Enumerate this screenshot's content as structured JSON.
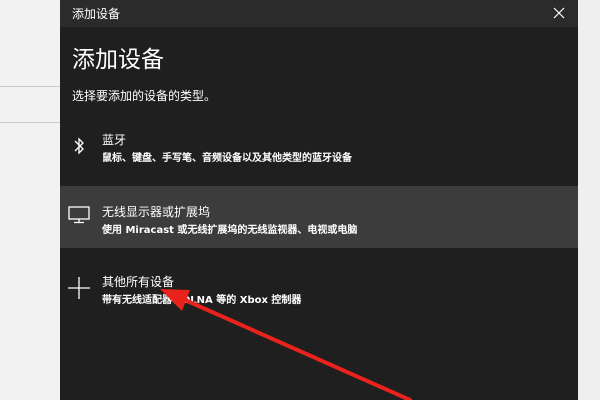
{
  "dialog": {
    "window_title": "添加设备",
    "heading": "添加设备",
    "subheading": "选择要添加的设备的类型。"
  },
  "options": [
    {
      "icon": "bluetooth-icon",
      "label": "蓝牙",
      "description": "鼠标、键盘、手写笔、音频设备以及其他类型的蓝牙设备"
    },
    {
      "icon": "monitor-icon",
      "label": "无线显示器或扩展坞",
      "description": "使用 Miracast 或无线扩展坞的无线监视器、电视或电脑"
    },
    {
      "icon": "plus-icon",
      "label": "其他所有设备",
      "description": "带有无线适配器、DLNA 等的 Xbox 控制器"
    }
  ],
  "colors": {
    "dialog_bg": "#1f1f1f",
    "titlebar_bg": "#2b2b2b",
    "selected_bg": "#3c3c3c",
    "annotation_arrow": "#e8231b"
  }
}
